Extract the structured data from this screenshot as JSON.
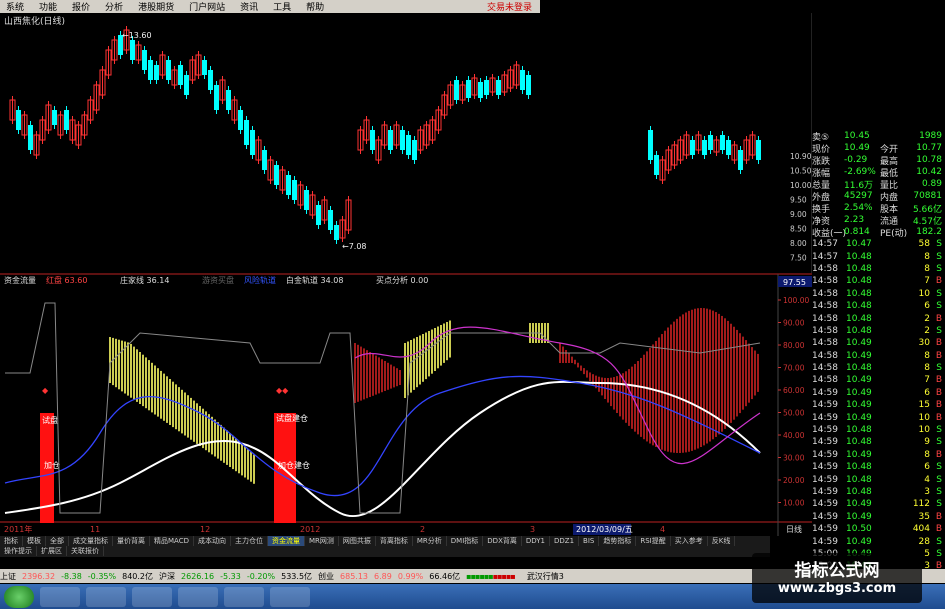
{
  "menu": {
    "items": [
      "系统",
      "功能",
      "报价",
      "分析",
      "港股期货",
      "门户网站",
      "资讯",
      "工具",
      "帮助"
    ],
    "login_status": "交易未登录"
  },
  "stock_name": "山西焦化(日线)",
  "price_chart": {
    "high_label": "13.60",
    "low_label": "7.08",
    "y_ticks": [
      "10.90",
      "10.50",
      "10.00",
      "9.50",
      "9.00",
      "8.50",
      "8.00",
      "7.50"
    ]
  },
  "indicator": {
    "header": [
      {
        "label": "资金流量",
        "color": "#ddd"
      },
      {
        "label": "红盘 63.60",
        "color": "#ff4444"
      },
      {
        "label": "庄家线 36.14",
        "color": "#ddd"
      },
      {
        "label": "游资买盘",
        "color": "#666"
      },
      {
        "label": "风险轨道",
        "color": "#3355ff"
      },
      {
        "label": "白金轨道 34.08",
        "color": "#ddd"
      },
      {
        "label": "买点分析 0.00",
        "color": "#ddd"
      }
    ],
    "current_value": "97.55",
    "y_ticks": [
      "100.00",
      "90.00",
      "80.00",
      "70.00",
      "60.00",
      "50.00",
      "40.00",
      "30.00",
      "20.00",
      "10.00"
    ],
    "labels": [
      "试盘",
      "加仓",
      "试盘建仓",
      "加仓建仓"
    ]
  },
  "time_axis": {
    "labels": [
      "2011年",
      "11",
      "12",
      "2012",
      "2",
      "3",
      "4"
    ],
    "selected_date": "2012/03/09/五",
    "period": "日线"
  },
  "quote": [
    {
      "l": "卖⑤",
      "v": "10.45",
      "l2": "",
      "v2": "1989"
    },
    {
      "l": "现价",
      "v": "10.49",
      "l2": "今开",
      "v2": "10.77"
    },
    {
      "l": "涨跌",
      "v": "-0.29",
      "l2": "最高",
      "v2": "10.78"
    },
    {
      "l": "涨幅",
      "v": "-2.69%",
      "l2": "最低",
      "v2": "10.42"
    },
    {
      "l": "总量",
      "v": "11.6万",
      "l2": "量比",
      "v2": "0.89"
    },
    {
      "l": "外盘",
      "v": "45297",
      "l2": "内盘",
      "v2": "70881"
    },
    {
      "l": "换手",
      "v": "2.54%",
      "l2": "股本",
      "v2": "5.66亿"
    },
    {
      "l": "净资",
      "v": "2.23",
      "l2": "流通",
      "v2": "4.57亿"
    },
    {
      "l": "收益(一)",
      "v": "0.814",
      "l2": "PE(动)",
      "v2": "182.2"
    }
  ],
  "ticks": [
    {
      "t": "14:57",
      "p": "10.47",
      "v": "58",
      "d": "S"
    },
    {
      "t": "14:57",
      "p": "10.48",
      "v": "8",
      "d": "S"
    },
    {
      "t": "14:58",
      "p": "10.48",
      "v": "8",
      "d": "S"
    },
    {
      "t": "14:58",
      "p": "10.48",
      "v": "7",
      "d": "B"
    },
    {
      "t": "14:58",
      "p": "10.48",
      "v": "10",
      "d": "S"
    },
    {
      "t": "14:58",
      "p": "10.48",
      "v": "6",
      "d": "S"
    },
    {
      "t": "14:58",
      "p": "10.48",
      "v": "2",
      "d": "B"
    },
    {
      "t": "14:58",
      "p": "10.48",
      "v": "2",
      "d": "S"
    },
    {
      "t": "14:58",
      "p": "10.49",
      "v": "30",
      "d": "B"
    },
    {
      "t": "14:58",
      "p": "10.49",
      "v": "8",
      "d": "B"
    },
    {
      "t": "14:58",
      "p": "10.48",
      "v": "8",
      "d": "S"
    },
    {
      "t": "14:58",
      "p": "10.49",
      "v": "7",
      "d": "B"
    },
    {
      "t": "14:59",
      "p": "10.49",
      "v": "6",
      "d": "B"
    },
    {
      "t": "14:59",
      "p": "10.49",
      "v": "15",
      "d": "B"
    },
    {
      "t": "14:59",
      "p": "10.49",
      "v": "10",
      "d": "B"
    },
    {
      "t": "14:59",
      "p": "10.48",
      "v": "10",
      "d": "S"
    },
    {
      "t": "14:59",
      "p": "10.48",
      "v": "9",
      "d": "S"
    },
    {
      "t": "14:59",
      "p": "10.49",
      "v": "8",
      "d": "B"
    },
    {
      "t": "14:59",
      "p": "10.48",
      "v": "6",
      "d": "S"
    },
    {
      "t": "14:59",
      "p": "10.48",
      "v": "4",
      "d": "S"
    },
    {
      "t": "14:59",
      "p": "10.48",
      "v": "3",
      "d": "S"
    },
    {
      "t": "14:59",
      "p": "10.49",
      "v": "112",
      "d": "S"
    },
    {
      "t": "14:59",
      "p": "10.49",
      "v": "35",
      "d": "B"
    },
    {
      "t": "14:59",
      "p": "10.50",
      "v": "404",
      "d": "B"
    },
    {
      "t": "14:59",
      "p": "10.49",
      "v": "28",
      "d": "S"
    },
    {
      "t": "15:00",
      "p": "10.49",
      "v": "5",
      "d": "S"
    },
    {
      "t": "15:00",
      "p": "10.49",
      "v": "3",
      "d": "B"
    }
  ],
  "indicator_tabs": [
    "指标",
    "模板",
    "全部",
    "成交量指标",
    "量价背离",
    "精品MACD",
    "成本动向",
    "主力仓位",
    "资金流量",
    "MR网测",
    "网图共振",
    "背离指标",
    "MR分析",
    "DMI指标",
    "DDX背离",
    "DDY1",
    "DDZ1",
    "BIS",
    "趋势指标",
    "RSI提醒",
    "买入参考",
    "反K线",
    "操作提示",
    "扩展区",
    "关联报价"
  ],
  "active_tab": "资金流量",
  "status_bar": {
    "sh_label": "上证",
    "sh_val": "2396.32",
    "sh_chg": "-8.38",
    "sh_pct": "-0.35%",
    "sh_amt": "840.2亿",
    "sz_label": "沪深",
    "sz_val": "2626.16",
    "sz_chg": "-5.33",
    "sz_pct": "-0.20%",
    "sz_amt": "533.5亿",
    "cy_label": "创业",
    "cy_val": "685.13",
    "cy_chg": "6.89",
    "cy_pct": "0.99%",
    "cy_amt": "66.46亿",
    "market_name": "武汉行情3"
  },
  "watermark": {
    "title": "指标公式网",
    "url": "www.zbgs3.com"
  },
  "colors": {
    "up": "#ff3333",
    "down": "#00ffff",
    "bar_yellow": "#ffff66",
    "bar_red": "#cc2222",
    "line_white": "#ffffff",
    "line_blue": "#3344ff"
  }
}
